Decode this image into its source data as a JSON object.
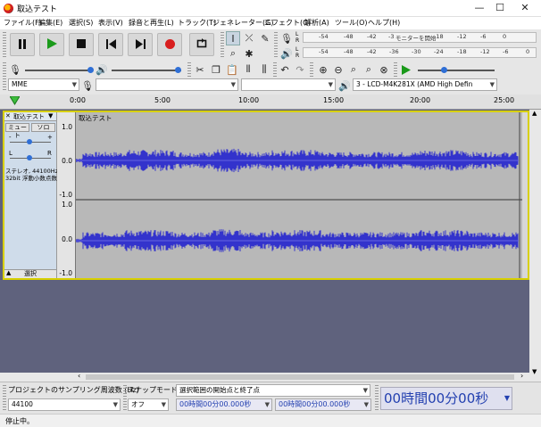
{
  "window": {
    "title": "取込テスト",
    "minimize": "—",
    "maximize": "☐",
    "close": "✕"
  },
  "menu": [
    "ファイル(F)",
    "編集(E)",
    "選択(S)",
    "表示(V)",
    "録音と再生(L)",
    "トラック(T)",
    "ジェネレーター(G)",
    "エフェクト(C)",
    "解析(A)",
    "ツール(O)",
    "ヘルプ(H)"
  ],
  "transport": {
    "pause": "pause-icon",
    "play": "play-icon",
    "stop": "stop-icon",
    "skip_start": "skip-start-icon",
    "skip_end": "skip-end-icon",
    "record": "record-icon",
    "loop": "loop-icon"
  },
  "meters": {
    "record_ticks": [
      "-54",
      "-48",
      "-42",
      "-3",
      "モニターを開始",
      "-18",
      "-12",
      "-6",
      "0"
    ],
    "play_ticks": [
      "-54",
      "-48",
      "-42",
      "-36",
      "-30",
      "-24",
      "-18",
      "-12",
      "-6",
      "0"
    ],
    "channel_l": "L",
    "channel_r": "R"
  },
  "device": {
    "host": "MME",
    "output": "3 - LCD-M4K281X (AMD High Defin"
  },
  "ruler": {
    "labels": [
      "0:00",
      "5:00",
      "10:00",
      "15:00",
      "20:00",
      "25:00"
    ]
  },
  "track": {
    "name": "取込テスト",
    "clip_name": "取込テスト",
    "mute": "ミュート",
    "solo": "ソロ",
    "gain_minus": "-",
    "gain_plus": "+",
    "pan_left": "L",
    "pan_right": "R",
    "info_line1": "ステレオ, 44100Hz",
    "info_line2": "32bit 浮動小数点数",
    "select": "選択",
    "scale": [
      "1.0",
      "0.0",
      "-1.0",
      "1.0",
      "0.0",
      "-1.0"
    ]
  },
  "selection": {
    "rate_label": "プロジェクトのサンプリング周波数 (Hz)",
    "rate_value": "44100",
    "snap_label": "スナップモード",
    "snap_value": "オフ",
    "range_label": "選択範囲の開始点と終了点",
    "start_time": "00時間00分00.000秒",
    "end_time": "00時間00分00.000秒",
    "big_time": "00時間00分00秒"
  },
  "status": {
    "text": "停止中。"
  },
  "colors": {
    "wave": "#3333cc",
    "wave_bg": "#b8b8b8",
    "track_bg": "#5f627d",
    "selected_outline": "#d8d000"
  }
}
